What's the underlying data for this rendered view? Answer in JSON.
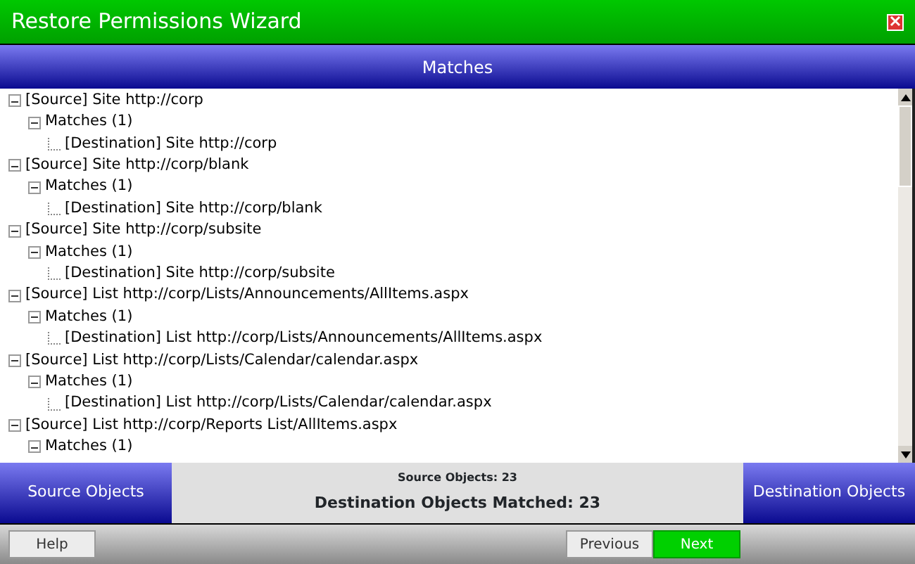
{
  "window": {
    "title": "Restore Permissions Wizard"
  },
  "header": "Matches",
  "tree": [
    {
      "label": "[Source] Site http://corp",
      "expanded": true,
      "children": [
        {
          "label": "Matches (1)",
          "expanded": true,
          "children": [
            {
              "label": "[Destination] Site http://corp"
            }
          ]
        }
      ]
    },
    {
      "label": "[Source] Site http://corp/blank",
      "expanded": true,
      "children": [
        {
          "label": "Matches (1)",
          "expanded": true,
          "children": [
            {
              "label": "[Destination] Site http://corp/blank"
            }
          ]
        }
      ]
    },
    {
      "label": "[Source] Site http://corp/subsite",
      "expanded": true,
      "children": [
        {
          "label": "Matches (1)",
          "expanded": true,
          "children": [
            {
              "label": "[Destination] Site http://corp/subsite"
            }
          ]
        }
      ]
    },
    {
      "label": "[Source] List http://corp/Lists/Announcements/AllItems.aspx",
      "expanded": true,
      "children": [
        {
          "label": "Matches (1)",
          "expanded": true,
          "children": [
            {
              "label": "[Destination] List http://corp/Lists/Announcements/AllItems.aspx"
            }
          ]
        }
      ]
    },
    {
      "label": "[Source] List http://corp/Lists/Calendar/calendar.aspx",
      "expanded": true,
      "children": [
        {
          "label": "Matches (1)",
          "expanded": true,
          "children": [
            {
              "label": "[Destination] List http://corp/Lists/Calendar/calendar.aspx"
            }
          ]
        }
      ]
    },
    {
      "label": "[Source] List http://corp/Reports List/AllItems.aspx",
      "expanded": true,
      "children": [
        {
          "label": "Matches (1)",
          "expanded": true
        }
      ]
    }
  ],
  "summary": {
    "left_button": "Source Objects",
    "source_count": "Source Objects: 23",
    "matched_count": "Destination Objects Matched: 23",
    "right_button": "Destination Objects"
  },
  "buttons": [
    {
      "label": "Help",
      "kind": "plain"
    },
    {
      "label": "Previous",
      "kind": "plain"
    },
    {
      "label": "Next",
      "kind": "primary"
    }
  ]
}
